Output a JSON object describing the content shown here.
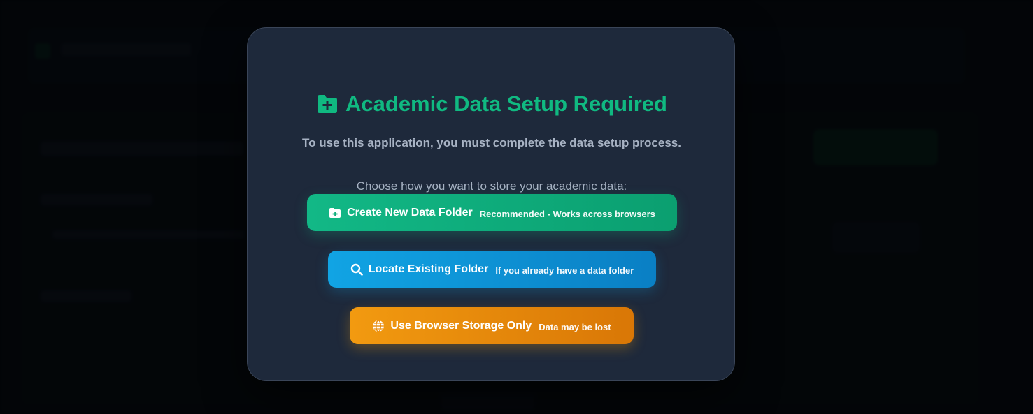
{
  "modal": {
    "title": "Academic Data Setup Required",
    "title_icon": "folder-plus-icon",
    "subtitle": "To use this application, you must complete the data setup process.",
    "prompt": "Choose how you want to store your academic data:",
    "options": [
      {
        "label": "Create New Data Folder",
        "sublabel": "Recommended - Works across browsers",
        "icon": "folder-plus-icon",
        "color": "#10b981"
      },
      {
        "label": "Locate Existing Folder",
        "sublabel": "If you already have a data folder",
        "icon": "search-icon",
        "color": "#0ea5e9"
      },
      {
        "label": "Use Browser Storage Only",
        "sublabel": "Data may be lost",
        "icon": "globe-icon",
        "color": "#f59e0b"
      }
    ]
  },
  "colors": {
    "accent": "#10b981",
    "modal_bg": "#1e293b",
    "muted_text": "#a8b3c4"
  }
}
